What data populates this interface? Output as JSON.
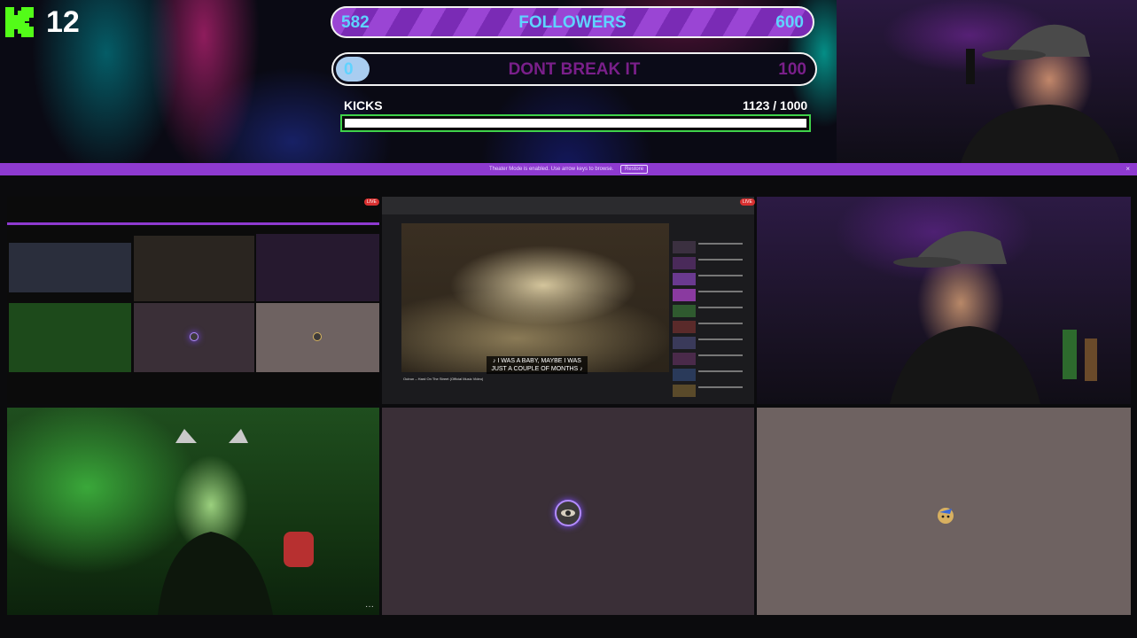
{
  "header": {
    "viewer_count": "12",
    "followers": {
      "current": "582",
      "label": "FOLLOWERS",
      "goal": "600"
    },
    "dont_break": {
      "current": "0",
      "label": "DONT BREAK IT",
      "goal": "100"
    },
    "kicks": {
      "label": "KICKS",
      "count": "1123  / 1000",
      "progress": 1.0
    }
  },
  "notice": {
    "text": "Theater Mode is enabled. Use arrow keys to browse.",
    "button_label": "Restore",
    "close_label": "×"
  },
  "tiles": {
    "live_label": "LIVE",
    "subtitle_line1": "♪ I WAS A BABY, MAYBE I WAS",
    "subtitle_line2": "JUST A COUPLE OF MONTHS ♪",
    "video_title": "Outrun – Hard On The Street (Official Music Video)",
    "more_label": "···"
  },
  "colors": {
    "accent_purple": "#8e3ad0",
    "followers_text": "#5fd3ff",
    "kicks_border": "#3fd24a",
    "live_red": "#d83030"
  },
  "icons": {
    "brand": "kick-logo-icon",
    "avatar_eye": "eye-avatar-icon",
    "avatar_character": "character-avatar-icon"
  }
}
